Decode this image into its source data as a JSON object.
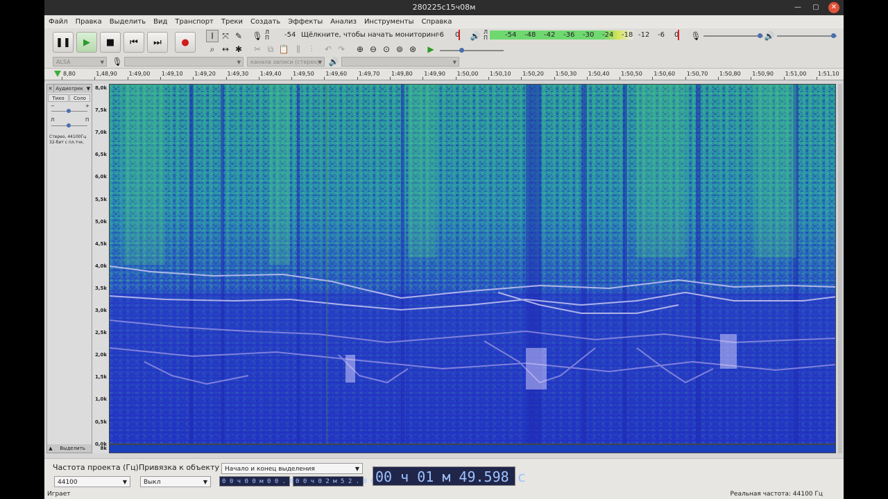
{
  "window": {
    "title": "280225с15ч08м"
  },
  "menu": [
    "Файл",
    "Правка",
    "Выделить",
    "Вид",
    "Транспорт",
    "Треки",
    "Создать",
    "Эффекты",
    "Анализ",
    "Инструменты",
    "Справка"
  ],
  "meters": {
    "rec_label": "Л\nП",
    "rec_scale": [
      "-54",
      "Щёлкните, чтобы начать мониторинг",
      "-6",
      "0"
    ],
    "play_label": "Л\nП",
    "play_scale": [
      "-54",
      "-48",
      "-42",
      "-36",
      "-30",
      "-24",
      "-18",
      "-12",
      "-6",
      "0"
    ],
    "rec_hint": "Щёлкните, чтобы начать мониторинг"
  },
  "devices": {
    "host": "ALSA",
    "channels": "канала записи (стерео)"
  },
  "ruler": {
    "ticks": [
      "8,80",
      "1,48,90",
      "1:49,00",
      "1:49,10",
      "1:49,20",
      "1:49,30",
      "1:49,40",
      "1:49,50",
      "1:49,60",
      "1:49,70",
      "1:49,80",
      "1:49,90",
      "1:50,00",
      "1:50,10",
      "1:50,20",
      "1:50,30",
      "1:50,40",
      "1:50,50",
      "1:50,60",
      "1:50,70",
      "1:50,80",
      "1:50,90",
      "1:51,00",
      "1:51,10"
    ]
  },
  "track": {
    "name": "Аудиотрек",
    "mute": "Тихо",
    "solo": "Соло",
    "gain_minus": "−",
    "gain_plus": "+",
    "pan_left": "Л",
    "pan_right": "П",
    "info_line1": "Стерео, 44100Гц",
    "info_line2": "32-бит с пл.тчк.",
    "select": "Выделить",
    "yticks": [
      "8,0k",
      "7,5k",
      "7,0k",
      "6,5k",
      "6,0k",
      "5,5k",
      "5,0k",
      "4,5k",
      "4,0k",
      "3,5k",
      "3,0k",
      "2,5k",
      "2,0k",
      "1,5k",
      "1,0k",
      "0,5k",
      "0,0k",
      "8k"
    ]
  },
  "selection": {
    "rate_label": "Частота проекта (Гц)",
    "rate_value": "44100",
    "snap_label": "Привязка к объекту",
    "snap_value": "Выкл",
    "mode": "Начало и конец выделения",
    "start": "0 0 ч 0 0 м 0 0 . 0 0 0 с",
    "end": "0 0 ч 0 2 м 5 2 . 8 0 0 с",
    "position": "00 ч 01 м 49.598 с"
  },
  "status": {
    "left": "Играет",
    "right": "Реальная частота: 44100 Гц"
  },
  "colors": {
    "spectrogram_low": "#2130c8",
    "spectrogram_mid": "#2aa6a0",
    "spectrogram_high": "#3fbf6a"
  }
}
